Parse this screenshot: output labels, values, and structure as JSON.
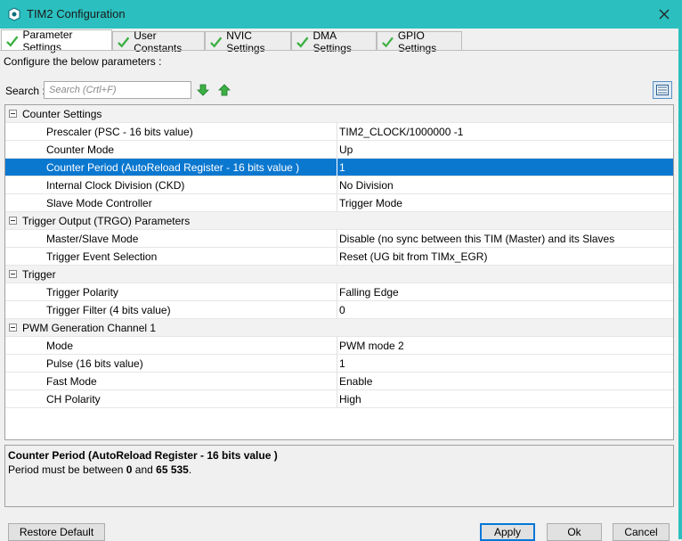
{
  "window": {
    "title": "TIM2 Configuration"
  },
  "tabs": [
    {
      "label": "Parameter Settings",
      "active": true
    },
    {
      "label": "User Constants",
      "active": false
    },
    {
      "label": "NVIC Settings",
      "active": false
    },
    {
      "label": "DMA Settings",
      "active": false
    },
    {
      "label": "GPIO Settings",
      "active": false
    }
  ],
  "configure_text": "Configure the below parameters :",
  "search": {
    "label": "Search :",
    "placeholder": "Search (Crtl+F)"
  },
  "groups": [
    {
      "label": "Counter Settings",
      "params": [
        {
          "name": "Prescaler (PSC - 16 bits value)",
          "value": "TIM2_CLOCK/1000000 -1"
        },
        {
          "name": "Counter Mode",
          "value": "Up"
        },
        {
          "name": "Counter Period (AutoReload Register - 16 bits value )",
          "value": "1",
          "selected": true
        },
        {
          "name": "Internal Clock Division (CKD)",
          "value": "No Division"
        },
        {
          "name": "Slave Mode Controller",
          "value": "Trigger Mode"
        }
      ]
    },
    {
      "label": "Trigger Output (TRGO) Parameters",
      "params": [
        {
          "name": "Master/Slave Mode",
          "value": "Disable (no sync between this TIM (Master) and its Slaves"
        },
        {
          "name": "Trigger Event Selection",
          "value": "Reset (UG bit from TIMx_EGR)"
        }
      ]
    },
    {
      "label": "Trigger",
      "params": [
        {
          "name": "Trigger Polarity",
          "value": "Falling Edge"
        },
        {
          "name": "Trigger Filter (4 bits value)",
          "value": "0"
        }
      ]
    },
    {
      "label": "PWM Generation Channel 1",
      "params": [
        {
          "name": "Mode",
          "value": "PWM mode 2"
        },
        {
          "name": "Pulse (16 bits value)",
          "value": "1"
        },
        {
          "name": "Fast Mode",
          "value": "Enable"
        },
        {
          "name": "CH Polarity",
          "value": "High"
        }
      ]
    }
  ],
  "description": {
    "title": "Counter Period (AutoReload Register - 16 bits value )",
    "text_prefix": "Period must be between ",
    "min": "0",
    "text_mid": " and ",
    "max": "65 535",
    "text_suffix": "."
  },
  "buttons": {
    "restore_default": "Restore Default",
    "apply": "Apply",
    "ok": "Ok",
    "cancel": "Cancel"
  },
  "colors": {
    "titlebar": "#2bbfbf",
    "selection": "#0b78d0",
    "check": "#3cb043",
    "arrow": "#3cb043"
  },
  "icons": {
    "title": "shield-cube-icon",
    "tab": "check-icon",
    "close": "close-icon",
    "search_down": "arrow-down-icon",
    "search_up": "arrow-up-icon",
    "view": "list-view-icon"
  }
}
